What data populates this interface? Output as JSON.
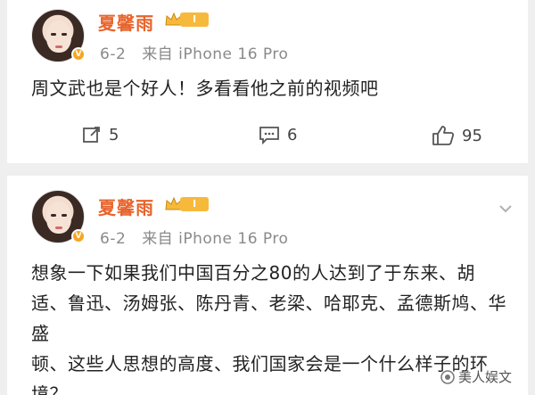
{
  "posts": [
    {
      "username": "夏馨雨",
      "vip_level": "I",
      "date": "6-2",
      "source": "来自 iPhone 16 Pro",
      "text": "周文武也是个好人！多看看他之前的视频吧",
      "repost_count": "5",
      "comment_count": "6",
      "like_count": "95"
    },
    {
      "username": "夏馨雨",
      "vip_level": "I",
      "date": "6-2",
      "source": "来自 iPhone 16 Pro",
      "text_lines": [
        "想象一下如果我们中国百分之80的人达到了于东来、胡",
        "适、鲁迅、汤姆张、陈丹青、老梁、哈耶克、孟德斯鸠、华盛",
        "顿、这些人思想的高度、我们国家会是一个什么样子的环",
        "境？"
      ]
    }
  ],
  "watermark": "美人娱文",
  "colors": {
    "username": "#e8642c",
    "vip": "#f6b93b",
    "verified": "#f6a623"
  }
}
